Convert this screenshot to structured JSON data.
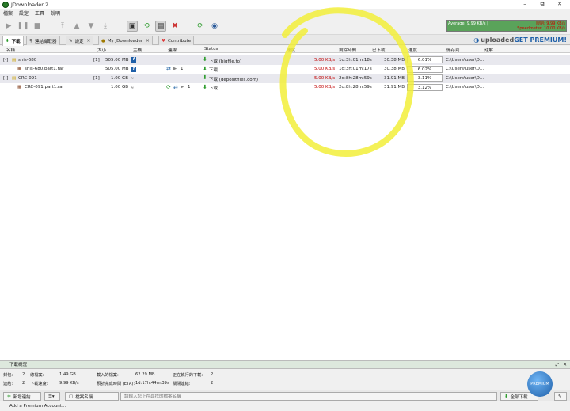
{
  "window": {
    "title": "JDownloader 2",
    "min": "–",
    "restore": "⧉",
    "close": "✕"
  },
  "menu": [
    "檔案",
    "設定",
    "工具",
    "說明"
  ],
  "speed_panel": {
    "average": "Average: 9.99 KB/s | ",
    "limit": "限制: 9.99 KB/s",
    "speedmeter": "Speedmeter: 10.00 KB/s"
  },
  "tabs": [
    {
      "label": "下載",
      "icon": "download-icon",
      "active": true
    },
    {
      "label": "連結擷取器",
      "icon": "linkgrabber-icon"
    },
    {
      "label": "設定",
      "icon": "settings-icon"
    },
    {
      "label": "My JDownloader",
      "icon": "myjd-icon"
    },
    {
      "label": "Contribute",
      "icon": "heart-icon"
    }
  ],
  "promo": {
    "brand": "uploaded",
    "cta": " GET PREMIUM!"
  },
  "columns": [
    "名稱",
    "大小",
    "主機",
    "連線",
    "Status",
    "速度",
    "剩餘時間",
    "已下載",
    "進度",
    "儲存到",
    "註解"
  ],
  "rows": [
    {
      "type": "package",
      "expander": "[-]",
      "name": "snis-680",
      "count": "[1]",
      "size": "505.00 MB",
      "conn": "",
      "status": "下載 (bigfile.to)",
      "speed": "5.00 KB/s",
      "eta": "1d:3h:01m:18s",
      "loaded": "30.38 MB",
      "progress": "6.01%",
      "progress_value": 6.01,
      "saveto": "C:\\Users\\user\\D..."
    },
    {
      "type": "file",
      "name": "snis-680.part1.rar",
      "size": "505.00 MB",
      "conn": "1",
      "status": "下載",
      "speed": "5.00 KB/s",
      "eta": "1d:3h:01m:17s",
      "loaded": "30.38 MB",
      "progress": "6.02%",
      "progress_value": 6.02,
      "saveto": "C:\\Users\\user\\D..."
    },
    {
      "type": "package",
      "expander": "[-]",
      "name": "CRC-091",
      "count": "[1]",
      "size": "1.00 GB",
      "conn": "",
      "status": "下載 (depositfiles.com)",
      "speed": "5.00 KB/s",
      "eta": "2d:8h:28m:59s",
      "loaded": "31.91 MB",
      "progress": "3.11%",
      "progress_value": 3.11,
      "saveto": "C:\\Users\\user\\D..."
    },
    {
      "type": "file",
      "name": "CRC-091.part1.rar",
      "size": "1.00 GB",
      "conn": "1",
      "status": "下載",
      "speed": "5.00 KB/s",
      "eta": "2d:8h:28m:59s",
      "loaded": "31.91 MB",
      "progress": "3.12%",
      "progress_value": 3.12,
      "saveto": "C:\\Users\\user\\D..."
    }
  ],
  "summary": {
    "title": "下載概況",
    "l1": [
      [
        "封包:",
        "2"
      ],
      [
        "總檔案:",
        "1.49 GB"
      ],
      [
        "載入的檔案:",
        "62.29 MB"
      ],
      [
        "正在執行的下載:",
        "2"
      ]
    ],
    "l2": [
      [
        "連結:",
        "2"
      ],
      [
        "下載速度:",
        "9.99 KB/s"
      ],
      [
        "預計完成時間 (ETA):",
        "1d:17h:44m:39s"
      ],
      [
        "關閉連結:",
        "2"
      ]
    ]
  },
  "bottom": {
    "add_links": "新增連結",
    "file_name_label": "檔案名稱",
    "search_placeholder": "請輸入您正在尋找的檔案名稱",
    "all_downloads": "全部下載"
  },
  "premium_badge": "PREMIUM",
  "status": {
    "add_account": "Add a Premium Account..."
  }
}
